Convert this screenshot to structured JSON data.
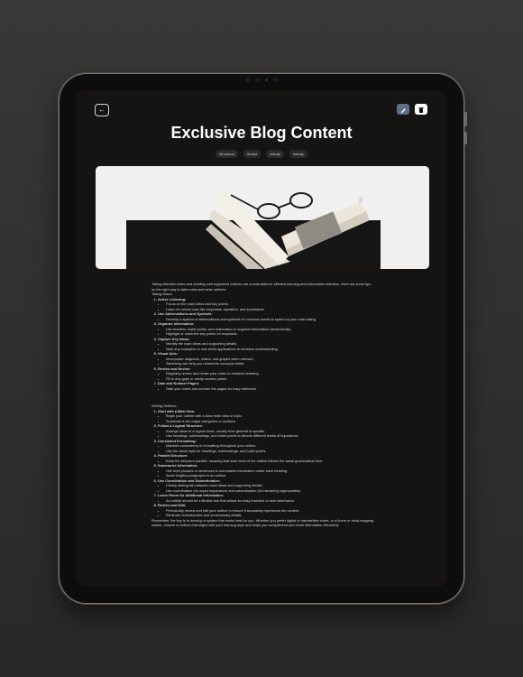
{
  "header": {
    "title": "Exclusive Blog Content",
    "back_label": "←"
  },
  "tags": [
    "#frontend",
    "#react",
    "#study",
    "#study"
  ],
  "article": {
    "intro": "Taking effective notes and creating well-organized outlines are crucial skills for efficient learning and information retention. Here are some tips on the right way to take notes and write outlines:",
    "taking_notes_heading": "Taking Notes:",
    "taking_notes": [
      {
        "title": "Active Listening:",
        "points": [
          "Focus on the main ideas and key points.",
          "Listen for verbal cues like emphasis, repetition, and summaries."
        ]
      },
      {
        "title": "Use Abbreviations and Symbols:",
        "points": [
          "Develop a system of abbreviations and symbols for common words to speed up your note-taking."
        ]
      },
      {
        "title": "Organize Information:",
        "points": [
          "Use headers, bullet points, and indentation to organize information hierarchically.",
          "Highlight or underline key points for emphasis."
        ]
      },
      {
        "title": "Capture Key Ideas:",
        "points": [
          "Identify the main ideas and supporting details.",
          "Note any examples or real-world applications to enhance understanding."
        ]
      },
      {
        "title": "Visual Aids:",
        "points": [
          "Incorporate diagrams, charts, and graphs when relevant.",
          "Sketching can help you remember concepts better."
        ]
      },
      {
        "title": "Review and Revise:",
        "points": [
          "Regularly review and revise your notes to reinforce learning.",
          "Fill in any gaps or clarify unclear points."
        ]
      },
      {
        "title": "Date and Number Pages:",
        "points": [
          "Date your notes and number the pages for easy reference."
        ]
      }
    ],
    "outlines_heading": "Writing Outlines:",
    "outlines": [
      {
        "title": "Start with a Main Idea:",
        "points": [
          "Begin your outline with a clear main idea or topic.",
          "Subdivide it into major categories or sections."
        ]
      },
      {
        "title": "Follow a Logical Structure:",
        "points": [
          "Arrange ideas in a logical order, usually from general to specific.",
          "Use headings, subheadings, and bullet points to denote different levels of importance."
        ]
      },
      {
        "title": "Consistent Formatting:",
        "points": [
          "Maintain consistency in formatting throughout your outline.",
          "Use the same style for headings, subheadings, and bullet points."
        ]
      },
      {
        "title": "Parallel Structure:",
        "points": [
          "Keep the structure parallel, meaning that each level of the outline follows the same grammatical form."
        ]
      },
      {
        "title": "Summarize Information:",
        "points": [
          "Use brief phrases or sentences to summarize information under each heading.",
          "Avoid lengthy paragraphs in an outline."
        ]
      },
      {
        "title": "Use Coordination and Subordination:",
        "points": [
          "Clearly distinguish between main ideas and supporting details.",
          "Use coordination (for equal importance) and subordination (for hierarchy) appropriately."
        ]
      },
      {
        "title": "Leave Room for Additional Information:",
        "points": [
          "An outline should be a flexible tool that allows for easy insertion of new information."
        ]
      },
      {
        "title": "Review and Edit:",
        "points": [
          "Periodically review and edit your outline to ensure it accurately represents the content.",
          "Eliminate redundancies and unnecessary details."
        ]
      }
    ],
    "conclusion": "Remember, the key is to develop a system that works best for you. Whether you prefer digital or handwritten notes, or a linear or mind-mapping outline, choose a method that aligns with your learning style and helps you comprehend and recall information effectively."
  },
  "colors": {
    "background": "#161412",
    "edit_button": "#5d6f86",
    "delete_button": "#ffffff"
  }
}
